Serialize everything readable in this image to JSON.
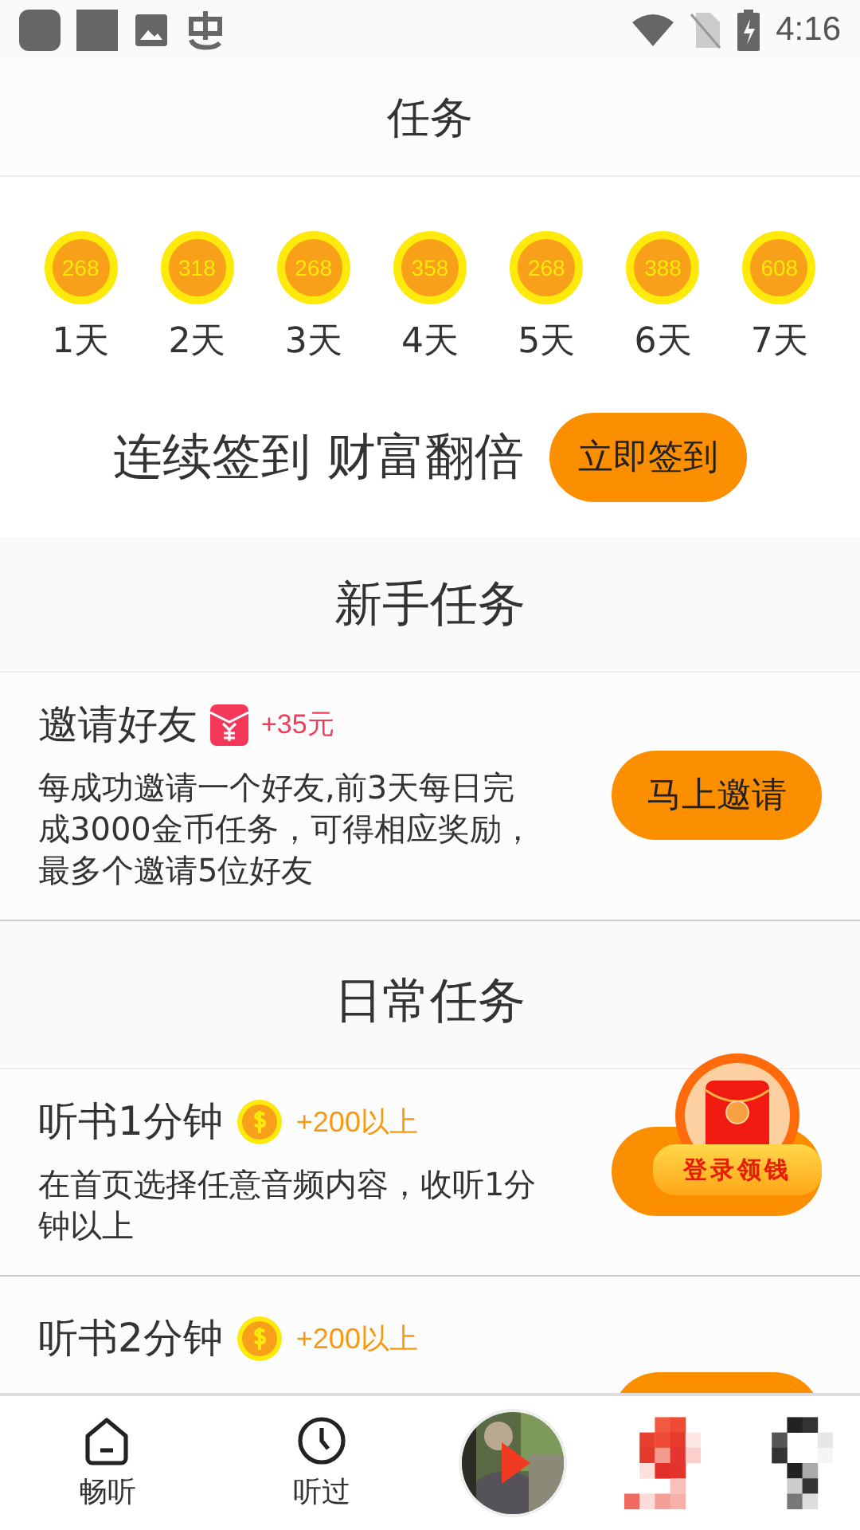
{
  "status_bar": {
    "time": "4:16"
  },
  "header": {
    "title": "任务"
  },
  "sign_in": {
    "days": [
      {
        "reward": "268",
        "label": "1天"
      },
      {
        "reward": "318",
        "label": "2天"
      },
      {
        "reward": "268",
        "label": "3天"
      },
      {
        "reward": "358",
        "label": "4天"
      },
      {
        "reward": "268",
        "label": "5天"
      },
      {
        "reward": "388",
        "label": "6天"
      },
      {
        "reward": "608",
        "label": "7天"
      }
    ],
    "slogan": "连续签到 财富翻倍",
    "button": "立即签到"
  },
  "sections": [
    {
      "title": "新手任务",
      "tasks": [
        {
          "title": "邀请好友",
          "kind": "cash",
          "reward": "+35元",
          "description": "每成功邀请一个好友,前3天每日完成3000金币任务，可得相应奖励，最多个邀请5位好友",
          "button": "马上邀请"
        }
      ]
    },
    {
      "title": "日常任务",
      "tasks": [
        {
          "title": "听书1分钟",
          "kind": "coin",
          "reward": "+200以上",
          "description": "在首页选择任意音频内容，收听1分钟以上"
        },
        {
          "title": "听书2分钟",
          "kind": "coin",
          "reward": "+200以上"
        }
      ]
    }
  ],
  "float_badge": {
    "label": "登录领钱"
  },
  "tab_bar": {
    "items": [
      {
        "kind": "home",
        "label": "畅听"
      },
      {
        "kind": "clock",
        "label": "听过"
      },
      {
        "kind": "player"
      },
      {
        "kind": "mosaic_red"
      },
      {
        "kind": "mosaic_dark"
      }
    ]
  }
}
